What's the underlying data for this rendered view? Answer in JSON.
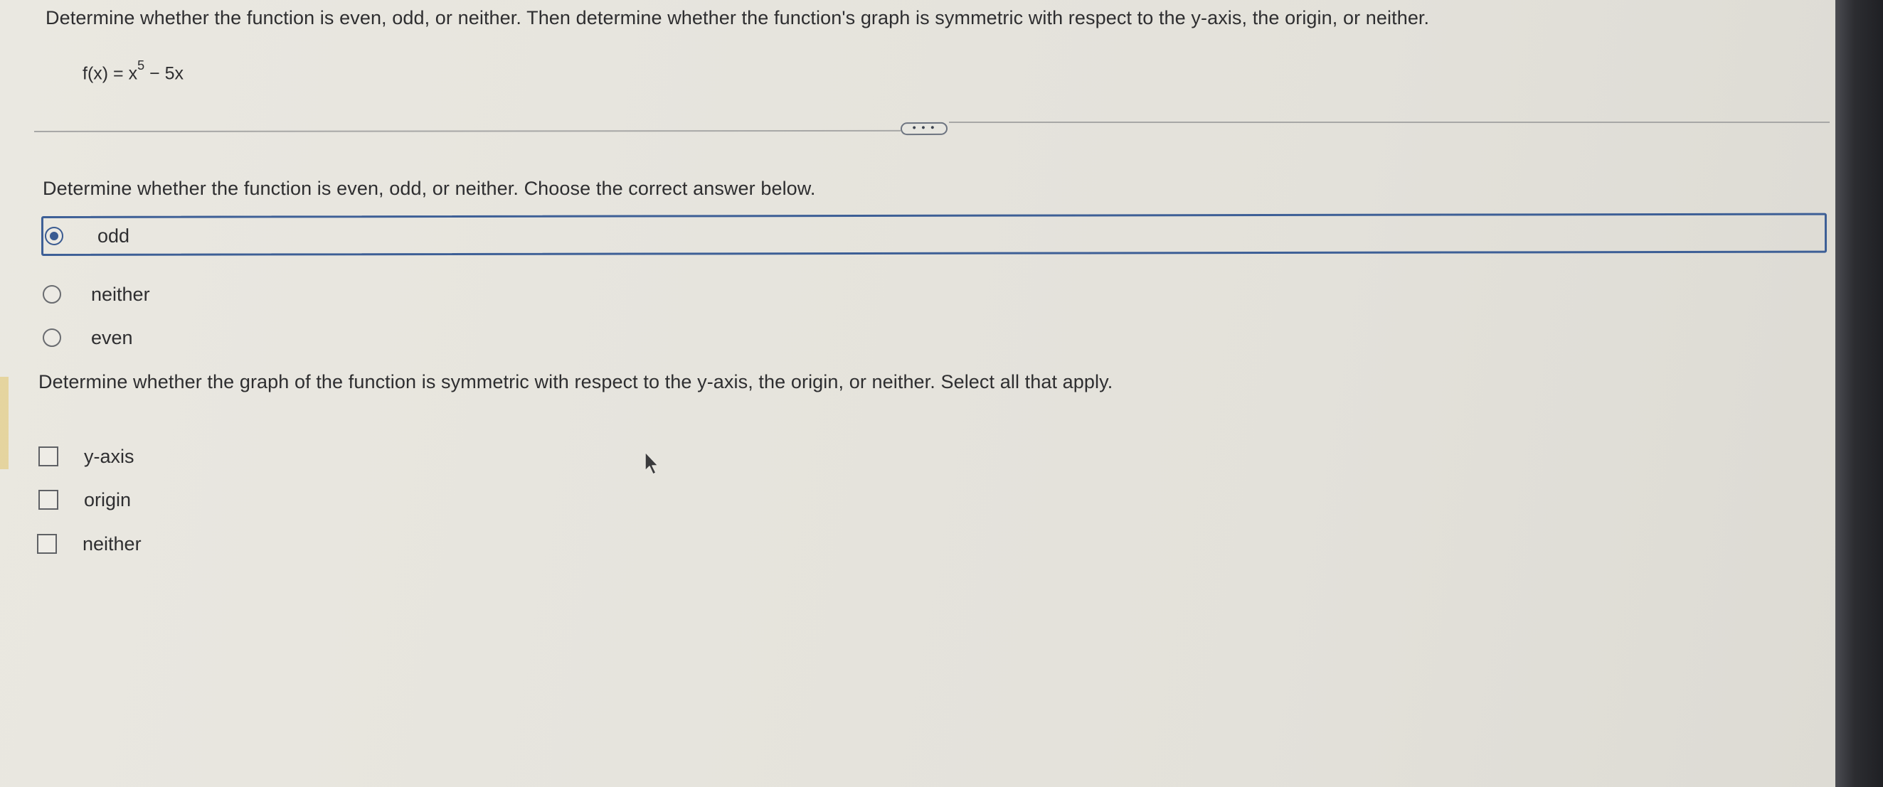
{
  "header": {
    "instructions": "Determine whether the function is even, odd, or neither. Then determine whether the function's graph is symmetric with respect to the y-axis, the origin, or neither.",
    "equation_prefix": "f(x) = x",
    "equation_exponent": "5",
    "equation_suffix": " − 5x"
  },
  "expand_button": {
    "label": "• • •"
  },
  "question1": {
    "prompt": "Determine whether the function is even, odd, or neither. Choose the correct answer below.",
    "options": [
      {
        "label": "odd",
        "selected": true
      },
      {
        "label": "neither",
        "selected": false
      },
      {
        "label": "even",
        "selected": false
      }
    ]
  },
  "question2": {
    "prompt": "Determine whether the graph of the function is symmetric with respect to the y-axis, the origin, or neither. Select all that apply.",
    "options": [
      {
        "label": "y-axis",
        "checked": false
      },
      {
        "label": "origin",
        "checked": false
      },
      {
        "label": "neither",
        "checked": false
      }
    ]
  },
  "colors": {
    "accent": "#3d5f96",
    "text": "#2e2e30",
    "background": "#e6e4dd"
  }
}
